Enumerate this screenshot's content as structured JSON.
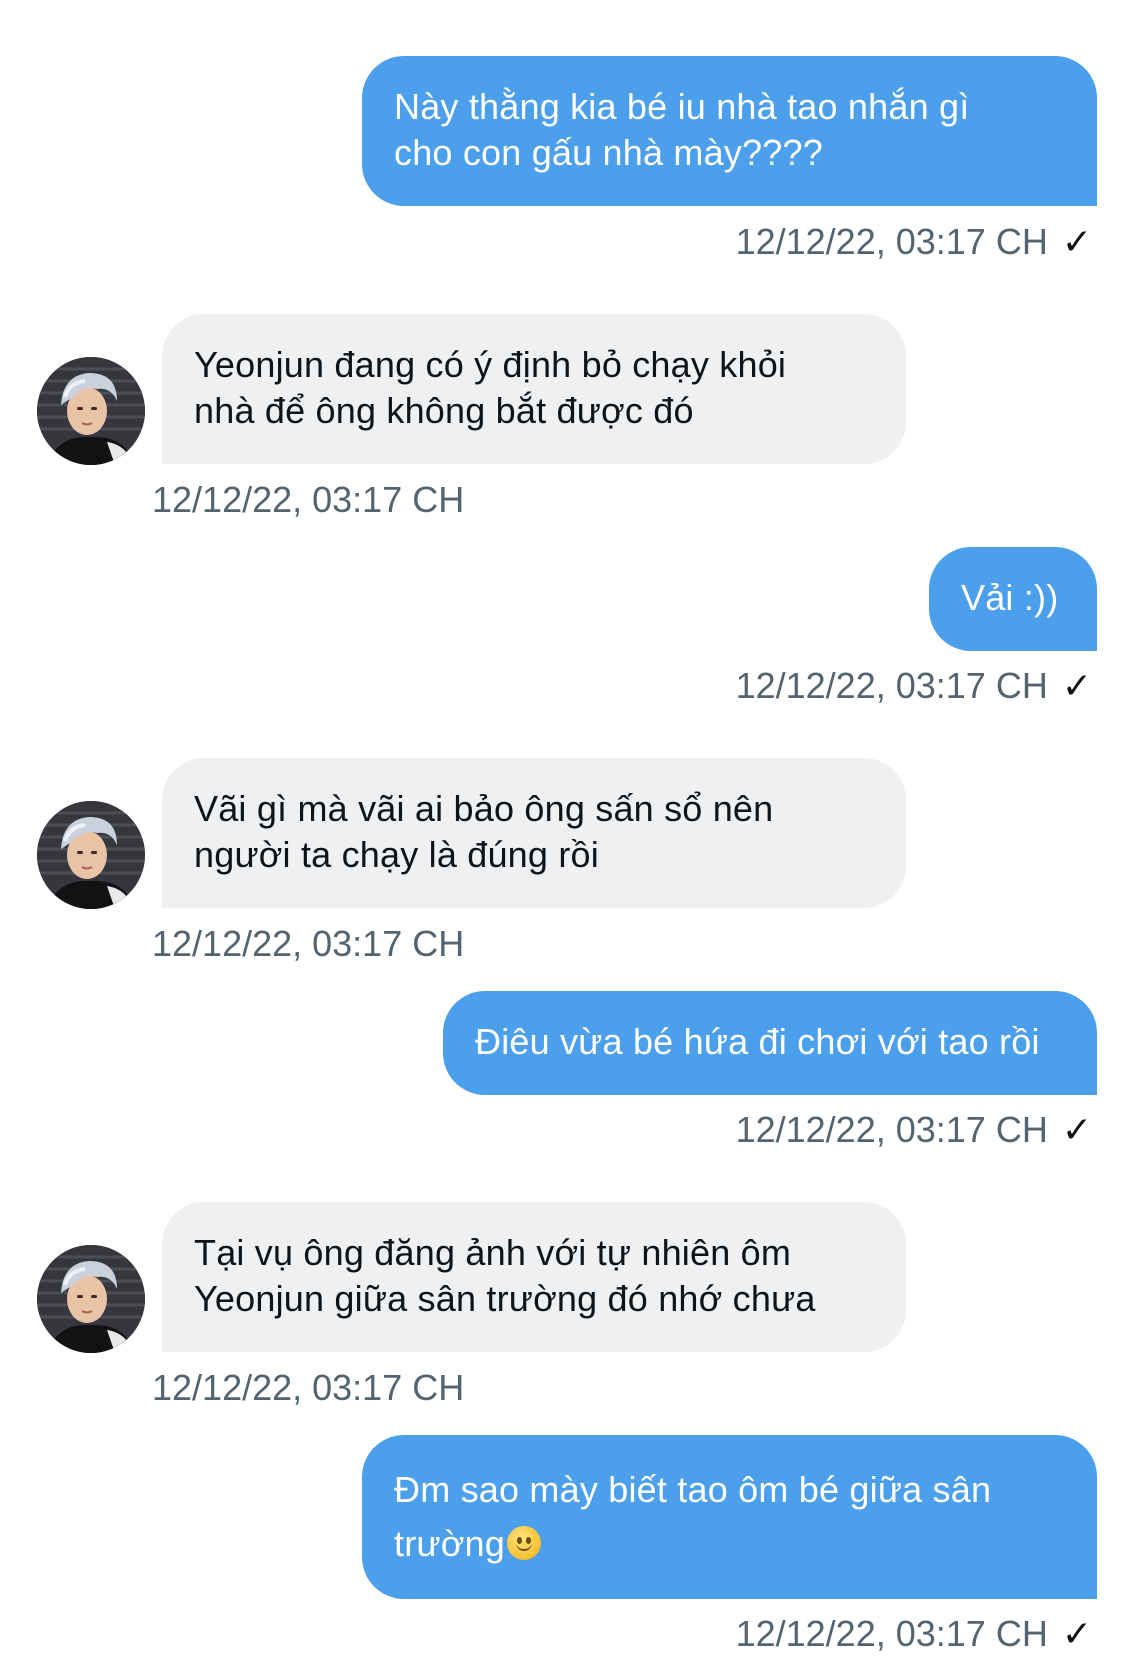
{
  "conversation": {
    "messages": [
      {
        "side": "sent",
        "lines": [
          "Này thằng kia bé iu nhà tao nhắn gì",
          "cho con gấu nhà mày????"
        ],
        "timestamp": "12/12/22, 03:17 CH",
        "read_mark": "✓"
      },
      {
        "side": "received",
        "lines": [
          "Yeonjun đang có ý định bỏ chạy khỏi",
          "nhà để ông không bắt được đó"
        ],
        "timestamp": "12/12/22, 03:17 CH"
      },
      {
        "side": "sent",
        "lines": [
          "Vải :))"
        ],
        "timestamp": "12/12/22, 03:17 CH",
        "read_mark": "✓"
      },
      {
        "side": "received",
        "lines": [
          "Vãi gì mà vãi ai bảo ông sấn sổ nên",
          "người ta chạy là đúng rồi"
        ],
        "timestamp": "12/12/22, 03:17 CH"
      },
      {
        "side": "sent",
        "lines": [
          "Điêu vừa bé hứa đi chơi với tao rồi"
        ],
        "timestamp": "12/12/22, 03:17 CH",
        "read_mark": "✓"
      },
      {
        "side": "received",
        "lines": [
          "Tại vụ ông đăng ảnh với tự nhiên ôm",
          "Yeonjun giữa sân trường đó nhớ chưa"
        ],
        "timestamp": "12/12/22, 03:17 CH"
      },
      {
        "side": "sent",
        "lines": [
          "Đm sao mày biết tao ôm bé giữa sân",
          "trường"
        ],
        "timestamp": "12/12/22, 03:17 CH",
        "read_mark": "✓",
        "emoji": "slightly-smiling-face"
      }
    ]
  },
  "colors": {
    "sent_bubble": "#4c9fea",
    "received_bubble": "#eef0f2",
    "timestamp_text": "#536471",
    "background": "#ffffff"
  }
}
